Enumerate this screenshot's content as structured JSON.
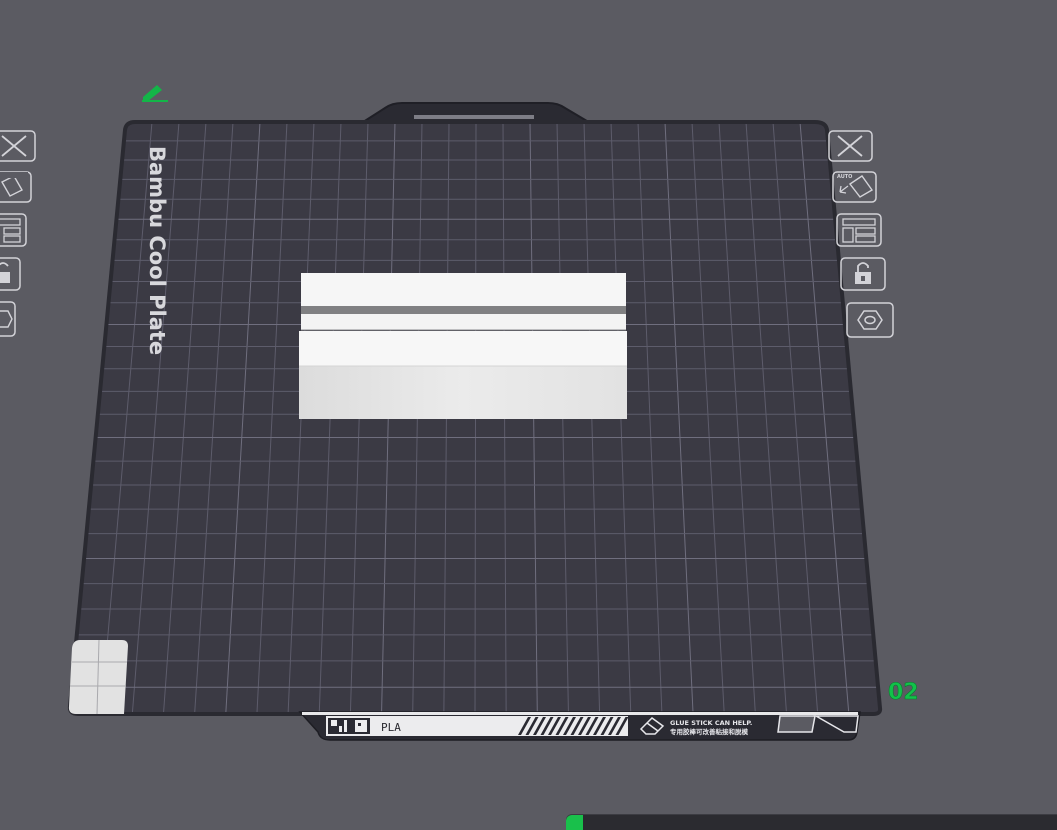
{
  "plate": {
    "name": "Bambu Cool Plate",
    "material_label": "PLA",
    "note_en": "GLUE STICK CAN HELP.",
    "note_cn": "专用胶棒可改善粘接和脱模",
    "index": "02"
  },
  "left_toolbar": [
    "close-icon",
    "auto-orient-icon",
    "arrange-icon",
    "lock-icon",
    "settings-hexagon-icon"
  ],
  "right_toolbar": [
    "close-icon",
    "auto-orient-icon",
    "arrange-icon",
    "lock-icon",
    "settings-hexagon-icon"
  ],
  "right_toolbar_badges": {
    "auto_orient": "AUTO"
  },
  "progress": {
    "fraction": 0.035
  },
  "colors": {
    "background": "#5b5b62",
    "plate": "#3b3a44",
    "grid": "#5d5c6b",
    "accent_green": "#12c24a",
    "model": "#f2f2f2"
  }
}
